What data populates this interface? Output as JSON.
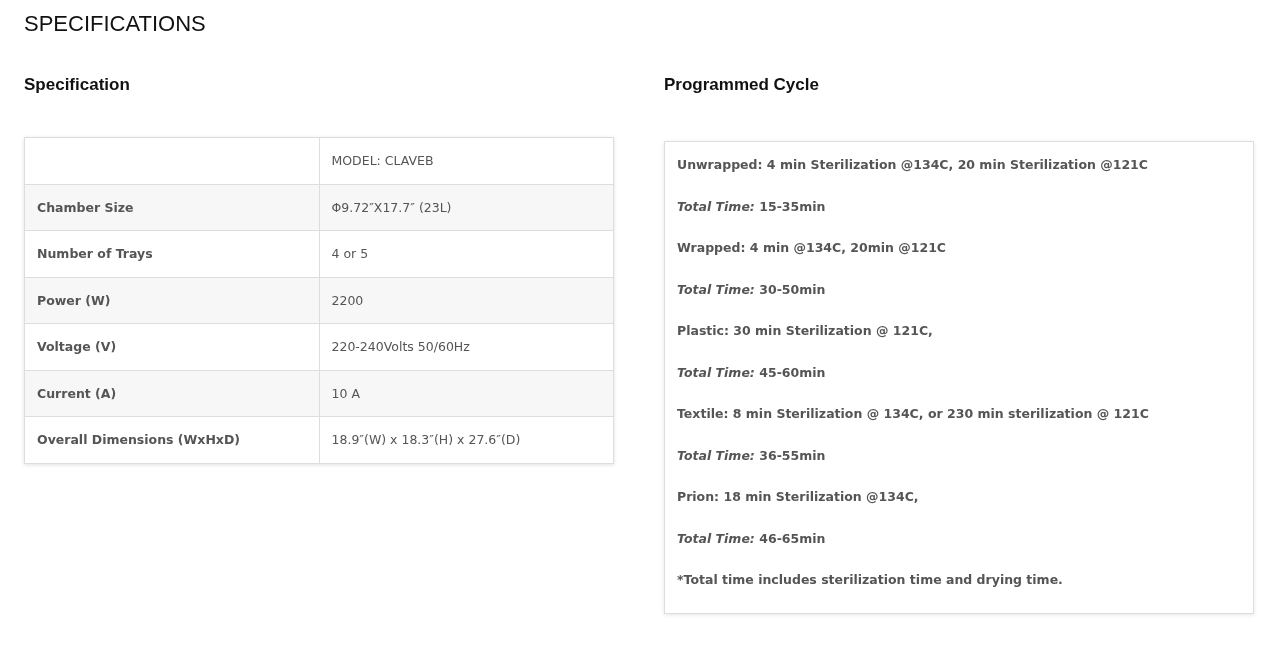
{
  "title": "SPECIFICATIONS",
  "specification": {
    "heading": "Specification",
    "model": "MODEL: CLAVEB",
    "rows": [
      [
        "Chamber Size",
        "Φ9.72″X17.7″ (23L)"
      ],
      [
        "Number of Trays",
        "4 or 5"
      ],
      [
        "Power (W)",
        "2200"
      ],
      [
        "Voltage (V)",
        "220-240Volts 50/60Hz"
      ],
      [
        "Current (A)",
        "10 A"
      ],
      [
        "Overall Dimensions (WxHxD)",
        "18.9″(W) x 18.3″(H) x 27.6″(D)"
      ]
    ]
  },
  "programmed_cycle": {
    "heading": "Programmed Cycle",
    "lines": [
      {
        "kind": "cycle",
        "text": "Unwrapped: 4 min Sterilization @134C, 20 min Sterilization @121C"
      },
      {
        "kind": "total",
        "label": "Total Time:",
        "text": "15-35min"
      },
      {
        "kind": "cycle",
        "text": "Wrapped: 4 min @134C, 20min @121C"
      },
      {
        "kind": "total",
        "label": "Total Time:",
        "text": "30-50min"
      },
      {
        "kind": "cycle",
        "text": "Plastic: 30 min Sterilization @ 121C,"
      },
      {
        "kind": "total",
        "label": "Total Time:",
        "text": "45-60min"
      },
      {
        "kind": "cycle",
        "text": "Textile: 8 min Sterilization @ 134C, or 230 min sterilization @ 121C"
      },
      {
        "kind": "total",
        "label": "Total Time:",
        "text": "36-55min"
      },
      {
        "kind": "cycle",
        "text": "Prion: 18 min Sterilization @134C,"
      },
      {
        "kind": "total",
        "label": "Total Time:",
        "text": "46-65min"
      },
      {
        "kind": "cycle",
        "text": "*Total time includes sterilization time and drying time."
      }
    ]
  }
}
